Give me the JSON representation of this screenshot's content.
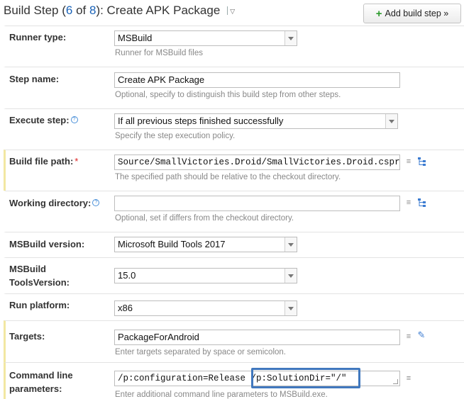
{
  "header": {
    "title_prefix": "Build Step (",
    "step_current": "6",
    "title_of": " of ",
    "step_total": "8",
    "title_suffix": "): Create APK Package",
    "caret": "▽",
    "add_build_step_label": "Add build step »",
    "add_icon": "+"
  },
  "form": {
    "runner_type": {
      "label": "Runner type:",
      "value": "MSBuild",
      "hint": "Runner for MSBuild files"
    },
    "step_name": {
      "label": "Step name:",
      "value": "Create APK Package",
      "hint": "Optional, specify to distinguish this build step from other steps."
    },
    "execute_step": {
      "label": "Execute step:",
      "help": "?",
      "value": "If all previous steps finished successfully",
      "hint": "Specify the step execution policy."
    },
    "build_file_path": {
      "label": "Build file path:",
      "required": "*",
      "value": "Source/SmallVictories.Droid/SmallVictories.Droid.csproj",
      "hint": "The specified path should be relative to the checkout directory."
    },
    "working_directory": {
      "label": "Working directory:",
      "help": "?",
      "value": "",
      "hint": "Optional, set if differs from the checkout directory."
    },
    "msbuild_version": {
      "label": "MSBuild version:",
      "value": "Microsoft Build Tools 2017"
    },
    "tools_version": {
      "label_line1": "MSBuild",
      "label_line2": "ToolsVersion:",
      "value": "15.0"
    },
    "run_platform": {
      "label": "Run platform:",
      "value": "x86"
    },
    "targets": {
      "label": "Targets:",
      "value": "PackageForAndroid",
      "hint": "Enter targets separated by space or semicolon."
    },
    "command_line": {
      "label_line1": "Command line",
      "label_line2": "parameters:",
      "value_part1": "/p:configuration=Release ",
      "value_part2": "/p:SolutionDir=\"/\"",
      "hint": "Enter additional command line parameters to MSBuild.exe."
    }
  },
  "icons": {
    "list": "≡",
    "wand": "✎"
  },
  "colors": {
    "accent_blue": "#1a63b8",
    "highlight_border": "#4178be",
    "required_red": "#d22222",
    "row_marker": "#f2e7a2"
  }
}
